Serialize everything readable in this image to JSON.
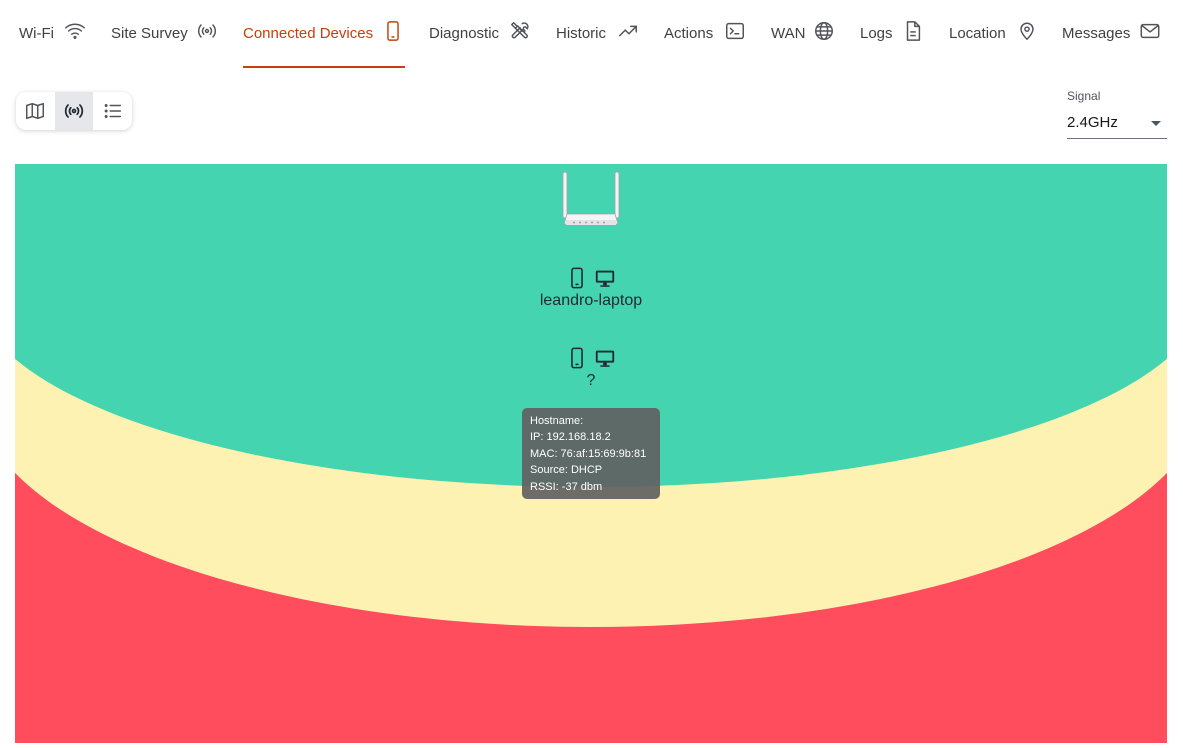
{
  "nav": {
    "tabs": [
      {
        "label": "Wi-Fi",
        "icon": "wifi-icon"
      },
      {
        "label": "Site Survey",
        "icon": "broadcast-icon"
      },
      {
        "label": "Connected Devices",
        "icon": "smartphone-icon",
        "active": true
      },
      {
        "label": "Diagnostic",
        "icon": "tools-icon"
      },
      {
        "label": "Historic",
        "icon": "trending-up-icon"
      },
      {
        "label": "Actions",
        "icon": "terminal-icon"
      },
      {
        "label": "WAN",
        "icon": "globe-icon"
      },
      {
        "label": "Logs",
        "icon": "document-icon"
      },
      {
        "label": "Location",
        "icon": "map-pin-icon"
      },
      {
        "label": "Messages",
        "icon": "envelope-icon"
      }
    ],
    "accent_color": "#c2410c"
  },
  "view_toggle": {
    "options": [
      {
        "icon": "map-icon"
      },
      {
        "icon": "broadcast-icon",
        "active": true
      },
      {
        "icon": "list-icon"
      }
    ]
  },
  "signal_select": {
    "label": "Signal",
    "value": "2.4GHz"
  },
  "map": {
    "zone_colors": {
      "strong": "#45d4b0",
      "medium": "#fdf2b2",
      "weak": "#ff4d5e"
    },
    "router_icon": "router-icon",
    "devices": [
      {
        "name": "leandro-laptop",
        "icons": [
          "smartphone-icon",
          "desktop-icon"
        ]
      },
      {
        "name": "?",
        "icons": [
          "smartphone-icon",
          "desktop-icon"
        ]
      }
    ],
    "tooltip": {
      "hostname": "Hostname:",
      "ip": "IP: 192.168.18.2",
      "mac": "MAC: 76:af:15:69:9b:81",
      "source": "Source: DHCP",
      "rssi": "RSSI: -37 dbm"
    }
  }
}
